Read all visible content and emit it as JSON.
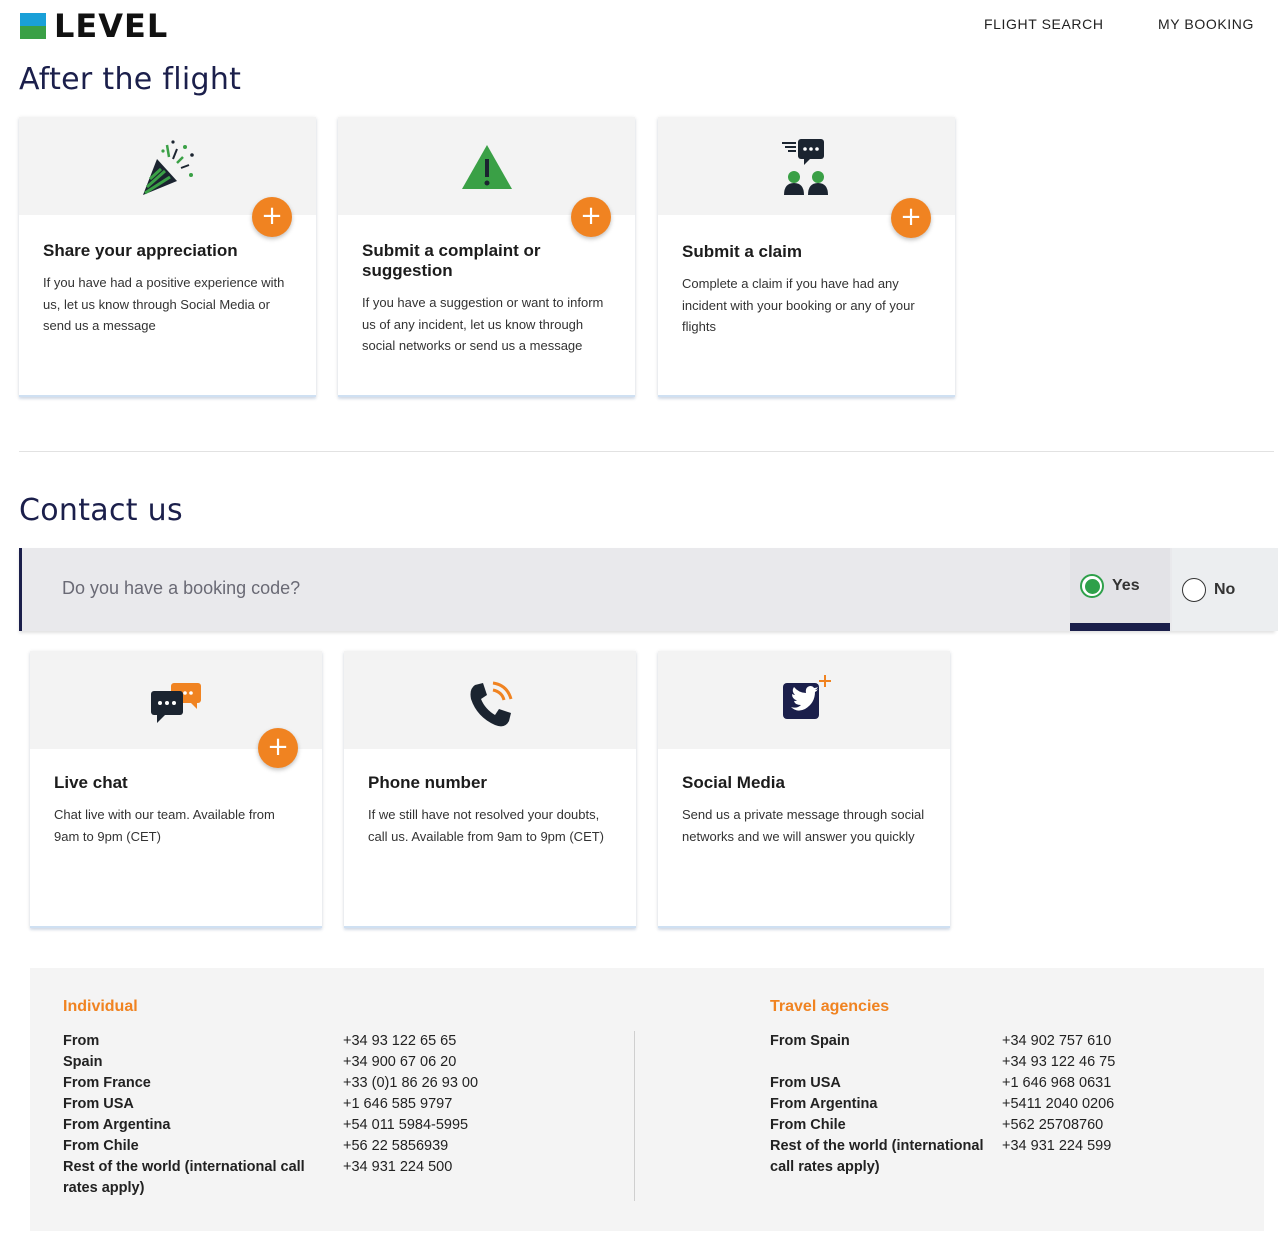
{
  "header": {
    "logo_text": "LEVEL",
    "nav": [
      "FLIGHT SEARCH",
      "MY BOOKING"
    ]
  },
  "after_flight": {
    "title": "After the flight",
    "cards": [
      {
        "icon": "party-popper-icon",
        "title": "Share your appreciation",
        "text": "If you have had a positive experience with us, let us know through Social Media or send us a message"
      },
      {
        "icon": "warning-icon",
        "title": "Submit a complaint or suggestion",
        "text": "If you have a suggestion or want to inform us of any incident, let us know through social networks or send us a message"
      },
      {
        "icon": "people-chat-icon",
        "title": "Submit a claim",
        "text": "Complete a claim if you have had any incident with your booking or any of your flights"
      }
    ]
  },
  "contact": {
    "title": "Contact us",
    "booking_question": "Do you have a booking code?",
    "options": {
      "yes": "Yes",
      "no": "No",
      "selected": "yes"
    },
    "cards": [
      {
        "icon": "chat-bubbles-icon",
        "title": "Live chat",
        "text": "Chat live with our team. Available from 9am to 9pm (CET)"
      },
      {
        "icon": "phone-icon",
        "title": "Phone number",
        "text": "If we still have not resolved your doubts, call us. Available from 9am to 9pm (CET)"
      },
      {
        "icon": "twitter-icon",
        "title": "Social Media",
        "text": "Send us a private message through social networks and we will answer you quickly"
      }
    ]
  },
  "phones": {
    "individual": {
      "title": "Individual",
      "rows": [
        {
          "place": "From Spain",
          "numbers": [
            "+34 93 122 65 65",
            "+34 900 67 06 20"
          ]
        },
        {
          "place": "From France",
          "numbers": [
            "+33 (0)1 86 26 93 00"
          ]
        },
        {
          "place": "From USA",
          "numbers": [
            "+1 646 585 9797"
          ]
        },
        {
          "place": "From Argentina",
          "numbers": [
            "+54 011 5984-5995"
          ]
        },
        {
          "place": "From Chile",
          "numbers": [
            "+56 22 5856939"
          ]
        },
        {
          "place": "Rest of the world (international call rates apply)",
          "numbers": [
            "+34 931 224 500"
          ]
        }
      ]
    },
    "agencies": {
      "title": "Travel agencies",
      "rows": [
        {
          "place": "From Spain",
          "numbers": [
            "+34 902 757 610",
            "+34 93 122 46 75"
          ]
        },
        {
          "place": "From USA",
          "numbers": [
            "+1 646 968 0631"
          ]
        },
        {
          "place": "From Argentina",
          "numbers": [
            "+5411 2040 0206"
          ]
        },
        {
          "place": "From Chile",
          "numbers": [
            "+562 25708760"
          ]
        },
        {
          "place": "Rest of the world (international call rates apply)",
          "numbers": [
            "+34 931 224 599"
          ]
        }
      ]
    }
  },
  "colors": {
    "accent": "#f08321",
    "navy": "#1b1f4b",
    "green": "#2ea04a"
  }
}
